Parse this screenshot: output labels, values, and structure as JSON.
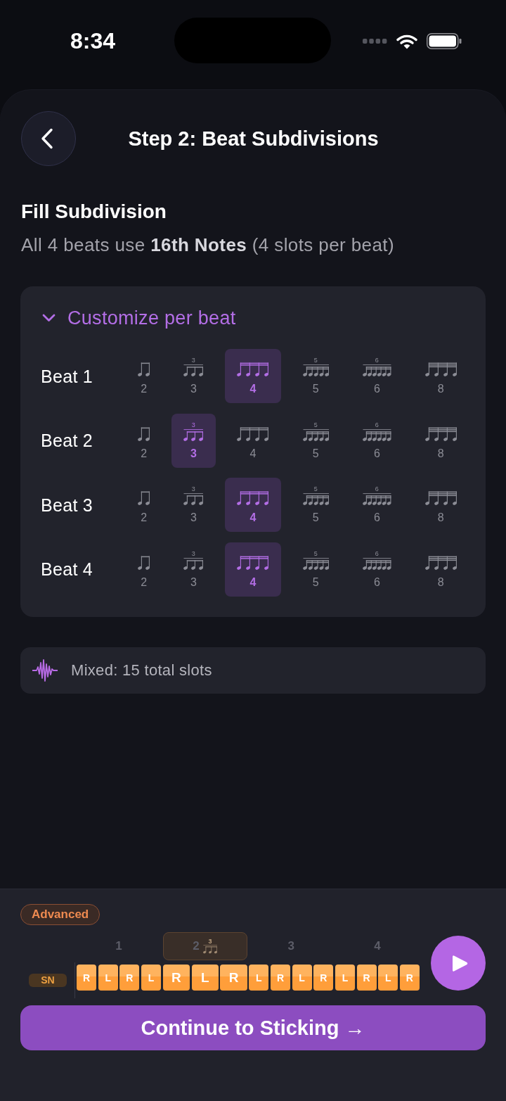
{
  "status_bar": {
    "time": "8:34"
  },
  "header": {
    "title": "Step 2: Beat Subdivisions"
  },
  "fill": {
    "title": "Fill Subdivision",
    "summary": "All 4 beats use **16th Notes** (4 slots per beat)"
  },
  "customize": {
    "label": "Customize per beat",
    "expanded": true,
    "beats": [
      {
        "label": "Beat 1",
        "options": [
          {
            "kind": "eighth",
            "value": "2",
            "selected": false
          },
          {
            "kind": "triplet",
            "tuplet": "3",
            "value": "3",
            "selected": false
          },
          {
            "kind": "sixteenth",
            "value": "4",
            "selected": true
          },
          {
            "kind": "quintuplet",
            "tuplet": "5",
            "value": "5",
            "selected": false
          },
          {
            "kind": "sextuplet",
            "tuplet": "6",
            "value": "6",
            "selected": false
          },
          {
            "kind": "thirtysecond",
            "value": "8",
            "selected": false
          }
        ]
      },
      {
        "label": "Beat 2",
        "options": [
          {
            "kind": "eighth",
            "value": "2",
            "selected": false
          },
          {
            "kind": "triplet",
            "tuplet": "3",
            "value": "3",
            "selected": true
          },
          {
            "kind": "sixteenth",
            "value": "4",
            "selected": false
          },
          {
            "kind": "quintuplet",
            "tuplet": "5",
            "value": "5",
            "selected": false
          },
          {
            "kind": "sextuplet",
            "tuplet": "6",
            "value": "6",
            "selected": false
          },
          {
            "kind": "thirtysecond",
            "value": "8",
            "selected": false
          }
        ]
      },
      {
        "label": "Beat 3",
        "options": [
          {
            "kind": "eighth",
            "value": "2",
            "selected": false
          },
          {
            "kind": "triplet",
            "tuplet": "3",
            "value": "3",
            "selected": false
          },
          {
            "kind": "sixteenth",
            "value": "4",
            "selected": true
          },
          {
            "kind": "quintuplet",
            "tuplet": "5",
            "value": "5",
            "selected": false
          },
          {
            "kind": "sextuplet",
            "tuplet": "6",
            "value": "6",
            "selected": false
          },
          {
            "kind": "thirtysecond",
            "value": "8",
            "selected": false
          }
        ]
      },
      {
        "label": "Beat 4",
        "options": [
          {
            "kind": "eighth",
            "value": "2",
            "selected": false
          },
          {
            "kind": "triplet",
            "tuplet": "3",
            "value": "3",
            "selected": false
          },
          {
            "kind": "sixteenth",
            "value": "4",
            "selected": true
          },
          {
            "kind": "quintuplet",
            "tuplet": "5",
            "value": "5",
            "selected": false
          },
          {
            "kind": "sextuplet",
            "tuplet": "6",
            "value": "6",
            "selected": false
          },
          {
            "kind": "thirtysecond",
            "value": "8",
            "selected": false
          }
        ]
      }
    ]
  },
  "summary": {
    "text": "Mixed: 15 total slots"
  },
  "footer": {
    "badge": "Advanced",
    "track": {
      "label": "SN",
      "beats": [
        {
          "label": "1",
          "kind": "plain",
          "selected": false,
          "slots": [
            "R",
            "L",
            "R",
            "L"
          ]
        },
        {
          "label": "2",
          "kind": "triplet",
          "tuplet": "3",
          "selected": true,
          "slots": [
            "R",
            "L",
            "R"
          ]
        },
        {
          "label": "3",
          "kind": "plain",
          "selected": false,
          "slots": [
            "L",
            "R",
            "L",
            "R"
          ]
        },
        {
          "label": "4",
          "kind": "plain",
          "selected": false,
          "slots": [
            "L",
            "R",
            "L",
            "R"
          ]
        }
      ]
    },
    "continue": "Continue to Sticking →"
  }
}
